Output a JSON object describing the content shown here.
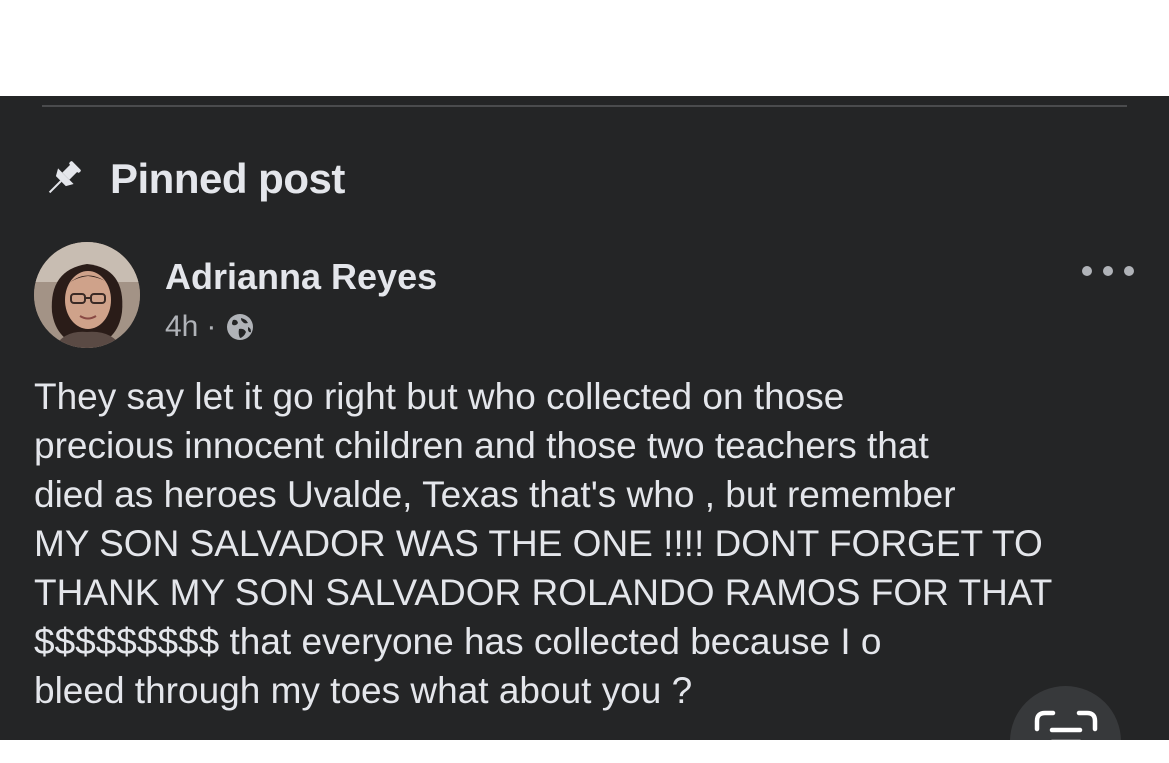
{
  "header": {
    "pinned_label": "Pinned post"
  },
  "post": {
    "author": "Adrianna Reyes",
    "time": "4h",
    "separator": "·",
    "privacy_icon": "globe-icon",
    "more_icon": "more-options-icon",
    "body": "They say let it go right but who collected on those\nprecious innocent children and those two teachers that\ndied as heroes Uvalde, Texas that's who , but remember\nMY SON SALVADOR WAS THE ONE !!!! DONT FORGET TO\nTHANK MY SON SALVADOR ROLANDO RAMOS FOR THAT\n$$$$$$$$$ that everyone has collected because I o\nbleed through my toes what about you ?"
  },
  "overlay": {
    "scan_icon": "text-scan-icon"
  },
  "colors": {
    "card_background": "#242526",
    "primary_text": "#e4e6eb",
    "secondary_text": "#b0b3b8",
    "divider": "#4a4b4d"
  }
}
